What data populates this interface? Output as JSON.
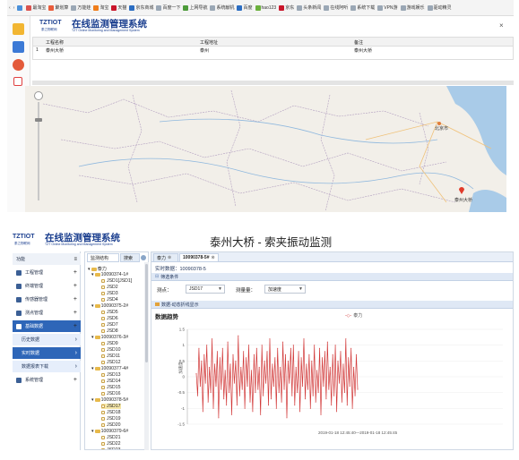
{
  "browser": {
    "bookmarks": [
      {
        "label": "",
        "color": "#4a90d9"
      },
      {
        "label": "最淘宝",
        "color": "#d9534f"
      },
      {
        "label": "聚划算",
        "color": "#e95d3c"
      },
      {
        "label": "万能娃",
        "color": "#9aa7b5"
      },
      {
        "label": "淘宝",
        "color": "#ef7d1a"
      },
      {
        "label": "天猫",
        "color": "#c9152a"
      },
      {
        "label": "京东商城",
        "color": "#2b6dc2"
      },
      {
        "label": "百度一下",
        "color": "#9aa7b5"
      },
      {
        "label": "上网导航",
        "color": "#4d9b3a"
      },
      {
        "label": "系统献机",
        "color": "#9aa7b5"
      },
      {
        "label": "百度",
        "color": "#2b6dc2"
      },
      {
        "label": "hao123",
        "color": "#6bb03d"
      },
      {
        "label": "京东",
        "color": "#c9152a"
      },
      {
        "label": "头条新闻",
        "color": "#9aa7b5"
      },
      {
        "label": "在线阿听",
        "color": "#9aa7b5"
      },
      {
        "label": "系统下载",
        "color": "#9aa7b5"
      },
      {
        "label": "VPN游",
        "color": "#9aa7b5"
      },
      {
        "label": "游戏娱乐",
        "color": "#9aa7b5"
      },
      {
        "label": "驱动精灵",
        "color": "#9aa7b5"
      }
    ]
  },
  "brand": {
    "logo": "TZTIOT",
    "reg": "®",
    "title": "在线监测管理系统",
    "company": "泰之物联网",
    "subtitle": "TZT Online Monitoring and Management System"
  },
  "top_table": {
    "headers": [
      "工程名称",
      "工程地址",
      "备注"
    ],
    "row": {
      "index": "1",
      "name": "泰州大桥",
      "address": "泰州",
      "remark": "泰州大桥"
    }
  },
  "map": {
    "labels": [
      "北京市",
      "泰州大桥"
    ]
  },
  "page_title": "泰州大桥 - 索夹振动监测",
  "menu": {
    "header": "功能",
    "items": [
      {
        "label": "工程管理",
        "kind": "main"
      },
      {
        "label": "终端管理",
        "kind": "main"
      },
      {
        "label": "传感器管理",
        "kind": "main"
      },
      {
        "label": "测点管理",
        "kind": "main"
      },
      {
        "label": "基础数据",
        "kind": "active"
      },
      {
        "label": "历史数据",
        "kind": "sub"
      },
      {
        "label": "实时数据",
        "kind": "sub-selected"
      },
      {
        "label": "数据报表下载",
        "kind": "sub"
      },
      {
        "label": "系统管理",
        "kind": "main"
      }
    ]
  },
  "tree": {
    "tabs": [
      "监测结构",
      "搜索"
    ],
    "root": "泰力",
    "nodes": [
      {
        "label": "10090374-1#",
        "level": 1,
        "folder": true
      },
      {
        "label": "JSD1[JSD1]",
        "level": 2
      },
      {
        "label": "JSD2",
        "level": 2
      },
      {
        "label": "JSD3",
        "level": 2
      },
      {
        "label": "JSD4",
        "level": 2
      },
      {
        "label": "10090375-2#",
        "level": 1,
        "folder": true
      },
      {
        "label": "JSD5",
        "level": 2
      },
      {
        "label": "JSD6",
        "level": 2
      },
      {
        "label": "JSD7",
        "level": 2
      },
      {
        "label": "JSD8",
        "level": 2
      },
      {
        "label": "10090376-3#",
        "level": 1,
        "folder": true
      },
      {
        "label": "JSD9",
        "level": 2
      },
      {
        "label": "JSD10",
        "level": 2
      },
      {
        "label": "JSD11",
        "level": 2
      },
      {
        "label": "JSD12",
        "level": 2
      },
      {
        "label": "10090377-4#",
        "level": 1,
        "folder": true
      },
      {
        "label": "JSD13",
        "level": 2
      },
      {
        "label": "JSD14",
        "level": 2
      },
      {
        "label": "JSD15",
        "level": 2
      },
      {
        "label": "JSD16",
        "level": 2
      },
      {
        "label": "10090378-5#",
        "level": 1,
        "folder": true
      },
      {
        "label": "JSD17",
        "level": 2,
        "selected": true
      },
      {
        "label": "JSD18",
        "level": 2
      },
      {
        "label": "JSD19",
        "level": 2
      },
      {
        "label": "JSD20",
        "level": 2
      },
      {
        "label": "10090379-6#",
        "level": 1,
        "folder": true
      },
      {
        "label": "JSD21",
        "level": 2
      },
      {
        "label": "JSD22",
        "level": 2
      },
      {
        "label": "JSD23",
        "level": 2
      }
    ]
  },
  "main": {
    "tabs": [
      "泰力",
      "10090378-5#"
    ],
    "realtime_label": "实时数据：10090378-5",
    "filter_bar": "筛选条件",
    "point_label": "测点：",
    "point_value": "JSD17",
    "amount_label": "测量量：",
    "amount_value": "加速度",
    "chart_bar": "数据-动态折线显示",
    "chart_heading": "数据趋势",
    "legend": "泰力",
    "ylabel": "加速度",
    "xlabel": "2019-01-18 12:45:40—2019-01-18 12:45:45",
    "accent": "#d23a3a"
  },
  "chart_data": {
    "type": "line",
    "ylim": [
      -1.5,
      1.5
    ],
    "yticks": [
      "1.5",
      "1",
      "0.5",
      "0",
      "-0.5",
      "-1",
      "-1.5"
    ],
    "series": [
      {
        "name": "泰力",
        "values": [
          0.1,
          -0.6,
          0.9,
          -0.3,
          0.5,
          -1.1,
          0.7,
          -0.2,
          1.0,
          -0.8,
          0.3,
          -0.5,
          1.2,
          -1.0,
          0.4,
          -0.3,
          0.8,
          -1.3,
          0.6,
          -0.4,
          0.9,
          -0.7,
          0.2,
          -0.9,
          1.1,
          -0.5,
          0.4,
          -1.2,
          0.7,
          -0.2,
          0.5,
          -0.9,
          1.3,
          -0.6,
          0.3,
          -0.4,
          0.8,
          -1.0,
          0.6,
          -0.3,
          1.0,
          -0.8,
          0.2,
          -1.1,
          0.7,
          -0.5,
          0.9,
          -0.4,
          0.3,
          -1.2,
          1.0,
          -0.6,
          0.5,
          -0.2,
          0.8,
          -0.9,
          1.2,
          -0.7,
          0.4,
          -0.3,
          0.6,
          -1.0,
          0.9,
          -0.5,
          0.3,
          -0.8,
          1.1,
          -0.4,
          0.7,
          -1.3,
          0.5,
          -0.2,
          0.9,
          -0.6,
          1.0,
          -0.9,
          0.3,
          -0.5,
          0.8,
          -1.1,
          0.6,
          -0.3,
          1.2,
          -0.7,
          0.4,
          -0.4,
          0.7,
          -1.0,
          0.5,
          -0.6,
          1.0,
          -0.8,
          0.2,
          -0.5,
          0.9,
          -1.2,
          0.6,
          -0.3,
          0.8,
          -0.7,
          1.1,
          -0.4,
          0.3,
          -0.9,
          0.7,
          -0.6,
          1.0,
          -1.1,
          0.5,
          -0.2,
          0.8,
          -0.8,
          0.4,
          -0.5,
          1.2,
          -0.9,
          0.6,
          -0.3,
          0.9,
          -1.0,
          0.3,
          -0.6,
          0.7,
          -0.4
        ]
      }
    ]
  }
}
